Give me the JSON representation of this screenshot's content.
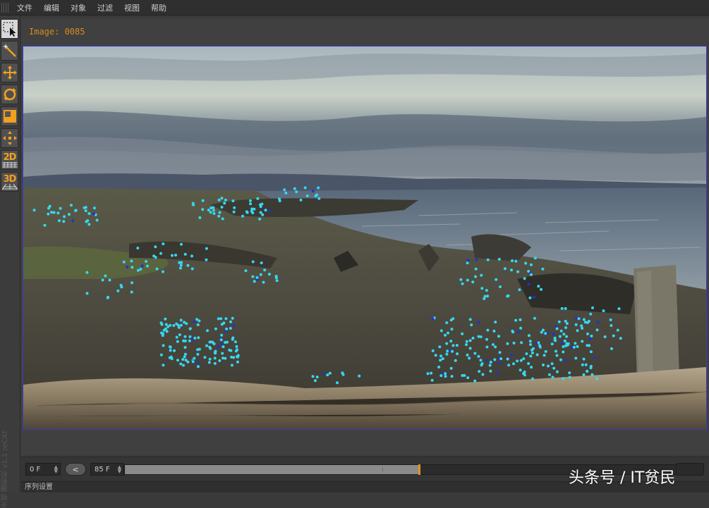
{
  "menu": {
    "items": [
      "文件",
      "编辑",
      "对象",
      "过滤",
      "视图",
      "帮助"
    ]
  },
  "toolbar": {
    "tools": [
      {
        "name": "marquee-select-icon",
        "active": true
      },
      {
        "name": "magic-wand-icon",
        "active": false
      },
      {
        "name": "move-icon",
        "active": false
      },
      {
        "name": "rotate-icon",
        "active": false
      },
      {
        "name": "scale-icon",
        "active": false
      },
      {
        "name": "expand-icon",
        "active": false
      },
      {
        "name": "2d-track-icon",
        "label": "2D"
      },
      {
        "name": "3d-track-icon",
        "label": "3D"
      }
    ],
    "vertical_label": "天视 摄影机 v1.1 reCAT"
  },
  "viewer": {
    "image_label": "Image: 0085"
  },
  "timeline": {
    "start_frame": "0 F",
    "prev_button": "<",
    "end_frame": "85 F",
    "progress": 0.51
  },
  "bottom_panel": {
    "label": "序列设置"
  },
  "watermark": "头条号 / IT贫民",
  "colors": {
    "accent_orange": "#e0941b",
    "track_point_cyan": "#35d8f2",
    "track_point_blue": "#2233cc"
  }
}
